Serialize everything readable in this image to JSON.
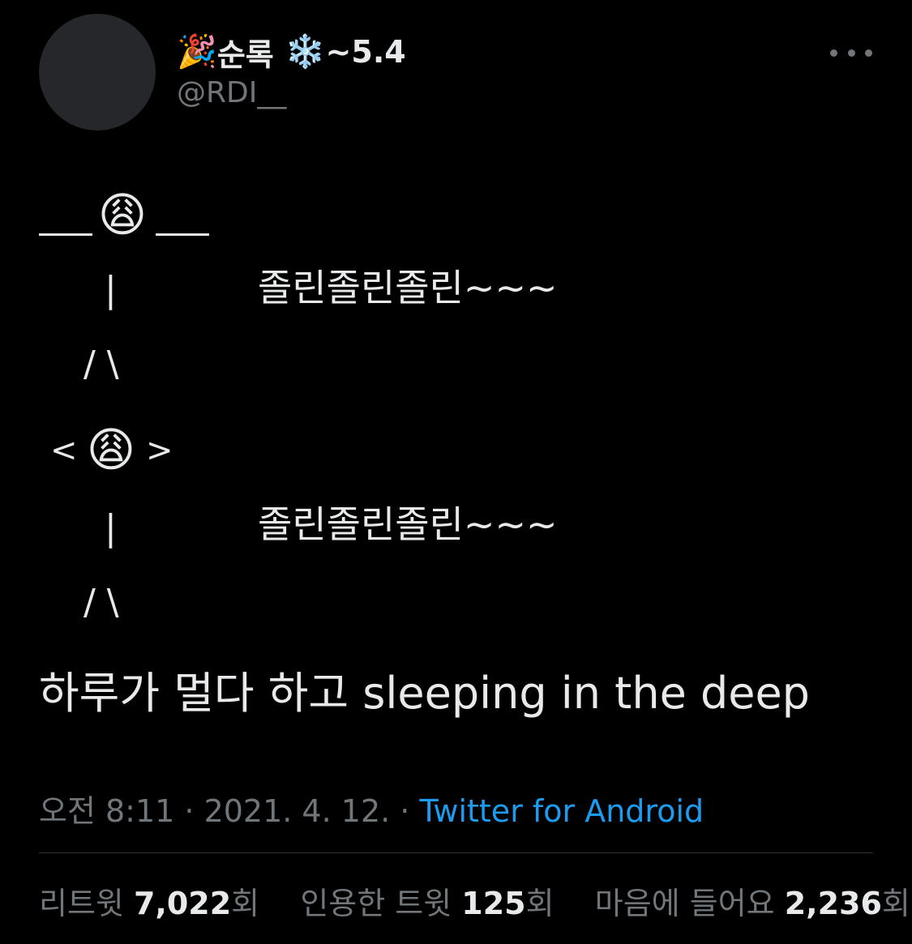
{
  "tweet": {
    "author": {
      "display_name_prefix_emoji": "🎉",
      "display_name": "순록",
      "display_name_suffix_emoji": "❄️",
      "display_name_suffix": "~5.4",
      "handle": "@RDI__"
    },
    "more_icon": "more-horizontal-icon",
    "ascii_art": {
      "figure1_emoji": "😩",
      "figure2_left": "<",
      "figure2_emoji": "😩",
      "figure2_right": ">",
      "body": "|",
      "legs": "/ \\",
      "sway_text_1": "졸린졸린졸린~~~",
      "sway_text_2": "졸린졸린졸린~~~"
    },
    "text": "하루가 멀다 하고 sleeping in the deep",
    "timestamp": "오전 8:11 · 2021. 4. 12. · ",
    "source": "Twitter for Android",
    "stats": {
      "retweets_label": "리트윗 ",
      "retweets_count": "7,022",
      "retweets_unit": "회",
      "quotes_label": "인용한 트윗 ",
      "quotes_count": "125",
      "quotes_unit": "회",
      "likes_label": "마음에 들어요 ",
      "likes_count": "2,236",
      "likes_unit": "회"
    }
  }
}
